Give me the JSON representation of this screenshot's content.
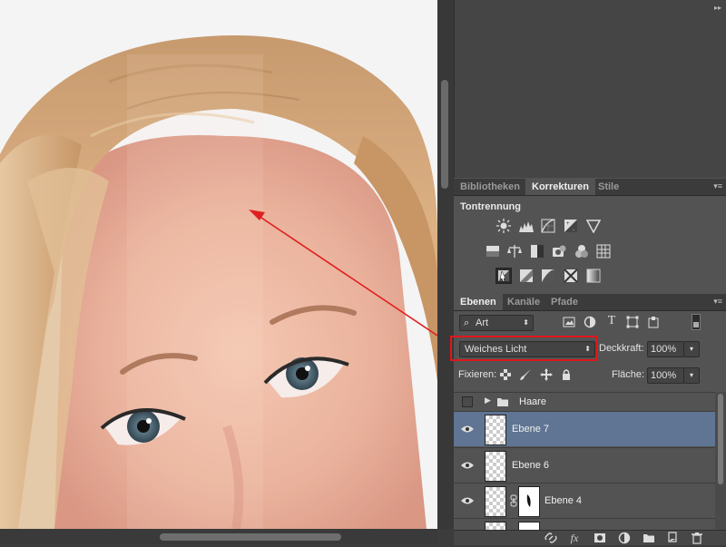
{
  "adjustments_panel": {
    "tabs": [
      {
        "label": "Bibliotheken",
        "active": false
      },
      {
        "label": "Korrekturen",
        "active": true
      },
      {
        "label": "Stile",
        "active": false
      }
    ],
    "section_title": "Tontrennung",
    "icons": [
      "brightness-contrast-icon",
      "levels-icon",
      "curves-icon",
      "exposure-icon",
      "vibrance-icon",
      "hue-saturation-icon",
      "color-balance-icon",
      "black-white-icon",
      "photo-filter-icon",
      "channel-mixer-icon",
      "color-lookup-icon",
      "invert-icon",
      "posterize-icon",
      "threshold-icon",
      "selective-color-icon",
      "gradient-map-icon"
    ]
  },
  "layers_panel": {
    "tabs": [
      {
        "label": "Ebenen",
        "active": true
      },
      {
        "label": "Kanäle",
        "active": false
      },
      {
        "label": "Pfade",
        "active": false
      }
    ],
    "filter_kind": "Art",
    "blend_mode": "Weiches Licht",
    "opacity_label": "Deckkraft:",
    "opacity_value": "100%",
    "lock_label": "Fixieren:",
    "fill_label": "Fläche:",
    "fill_value": "100%",
    "layers": [
      {
        "name": "Haare",
        "type": "group",
        "visible": false,
        "selected": false
      },
      {
        "name": "Ebene 7",
        "type": "layer",
        "visible": true,
        "selected": true
      },
      {
        "name": "Ebene 6",
        "type": "layer",
        "visible": true,
        "selected": false
      },
      {
        "name": "Ebene 4",
        "type": "masked",
        "visible": true,
        "selected": false
      }
    ],
    "bottom_icons": [
      "link-icon",
      "fx-icon",
      "mask-icon",
      "adjustment-icon",
      "folder-icon",
      "new-layer-icon",
      "trash-icon"
    ]
  },
  "colors": {
    "panel_bg": "#535353",
    "selected_layer": "#5f7593",
    "highlight_box": "#e0161b",
    "arrow": "#e02020"
  }
}
